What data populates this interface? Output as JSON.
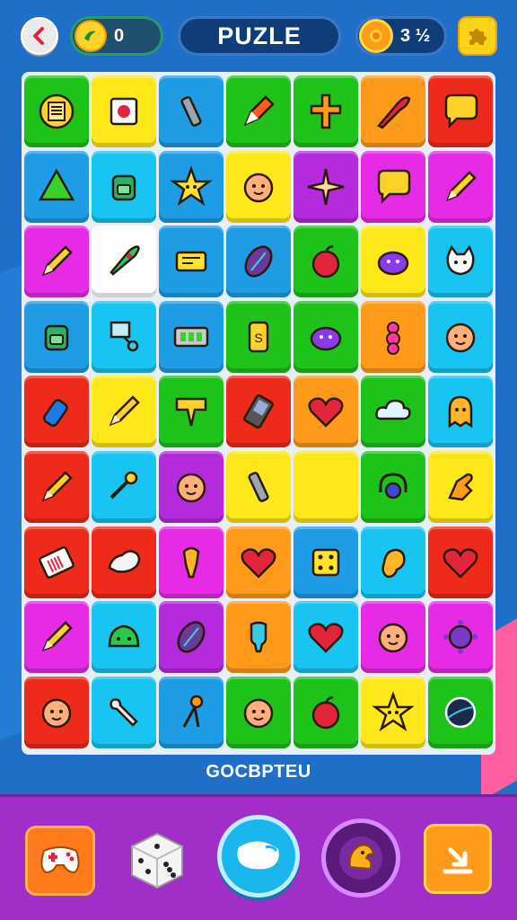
{
  "header": {
    "coins_value": "0",
    "title": "PUZLE",
    "sun_value": "3 ½"
  },
  "word": "GOCBPTEU",
  "colors": {
    "green": "#1ec31a",
    "yellow": "#ffe81a",
    "blue": "#1e9de6",
    "cyan": "#18c4f2",
    "orange": "#ff9a1a",
    "red": "#ee2a1a",
    "magenta": "#e62ae6",
    "purple": "#b62ade",
    "white": "#ffffff"
  },
  "board": [
    [
      {
        "c": "green",
        "i": "receipt"
      },
      {
        "c": "yellow",
        "i": "stamp"
      },
      {
        "c": "blue",
        "i": "usb-stick"
      },
      {
        "c": "green",
        "i": "marker"
      },
      {
        "c": "green",
        "i": "cross"
      },
      {
        "c": "orange",
        "i": "knife"
      },
      {
        "c": "red",
        "i": "speech-bubble"
      }
    ],
    [
      {
        "c": "blue",
        "i": "triangle"
      },
      {
        "c": "cyan",
        "i": "backpack"
      },
      {
        "c": "blue",
        "i": "star-face"
      },
      {
        "c": "yellow",
        "i": "face"
      },
      {
        "c": "purple",
        "i": "spark"
      },
      {
        "c": "magenta",
        "i": "speech-bubble"
      },
      {
        "c": "magenta",
        "i": "pencil"
      }
    ],
    [
      {
        "c": "magenta",
        "i": "pencil"
      },
      {
        "c": "white",
        "i": "rocket"
      },
      {
        "c": "blue",
        "i": "ticket"
      },
      {
        "c": "blue",
        "i": "leaf"
      },
      {
        "c": "green",
        "i": "apple"
      },
      {
        "c": "yellow",
        "i": "monster"
      },
      {
        "c": "cyan",
        "i": "cat"
      }
    ],
    [
      {
        "c": "blue",
        "i": "backpack"
      },
      {
        "c": "cyan",
        "i": "magnifier"
      },
      {
        "c": "blue",
        "i": "keyboard"
      },
      {
        "c": "green",
        "i": "can"
      },
      {
        "c": "green",
        "i": "monster"
      },
      {
        "c": "orange",
        "i": "gummy"
      },
      {
        "c": "cyan",
        "i": "face"
      }
    ],
    [
      {
        "c": "red",
        "i": "bottle"
      },
      {
        "c": "yellow",
        "i": "pencil"
      },
      {
        "c": "green",
        "i": "sign"
      },
      {
        "c": "red",
        "i": "phone"
      },
      {
        "c": "orange",
        "i": "heart"
      },
      {
        "c": "green",
        "i": "cloud"
      },
      {
        "c": "cyan",
        "i": "ghost"
      }
    ],
    [
      {
        "c": "red",
        "i": "pencil"
      },
      {
        "c": "cyan",
        "i": "key"
      },
      {
        "c": "purple",
        "i": "face"
      },
      {
        "c": "yellow",
        "i": "usb-stick"
      },
      {
        "c": "yellow",
        "i": "empty"
      },
      {
        "c": "green",
        "i": "headphones"
      },
      {
        "c": "yellow",
        "i": "hand"
      }
    ],
    [
      {
        "c": "red",
        "i": "barcode"
      },
      {
        "c": "red",
        "i": "splash"
      },
      {
        "c": "magenta",
        "i": "idol"
      },
      {
        "c": "orange",
        "i": "heart"
      },
      {
        "c": "blue",
        "i": "dice"
      },
      {
        "c": "cyan",
        "i": "ear"
      },
      {
        "c": "red",
        "i": "heart"
      }
    ],
    [
      {
        "c": "magenta",
        "i": "pencil"
      },
      {
        "c": "cyan",
        "i": "blob"
      },
      {
        "c": "purple",
        "i": "leaf"
      },
      {
        "c": "orange",
        "i": "tooth"
      },
      {
        "c": "cyan",
        "i": "heart"
      },
      {
        "c": "magenta",
        "i": "face"
      },
      {
        "c": "magenta",
        "i": "virus"
      }
    ],
    [
      {
        "c": "red",
        "i": "face"
      },
      {
        "c": "cyan",
        "i": "wrench"
      },
      {
        "c": "blue",
        "i": "scissors"
      },
      {
        "c": "green",
        "i": "face"
      },
      {
        "c": "green",
        "i": "apple"
      },
      {
        "c": "yellow",
        "i": "star-face"
      },
      {
        "c": "green",
        "i": "planet"
      }
    ]
  ],
  "bottom": {
    "game_icon": "gamepad-icon",
    "dice_icon": "dice-icon",
    "main_icon": "bubble-icon",
    "power_icon": "dragon-icon",
    "exit_icon": "exit-icon"
  }
}
